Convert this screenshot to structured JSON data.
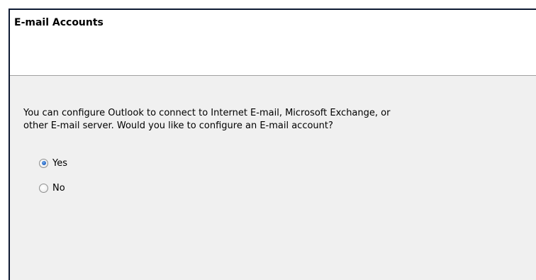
{
  "dialog": {
    "title": "E-mail Accounts"
  },
  "content": {
    "description_line1": "You can configure Outlook to connect to Internet E-mail, Microsoft Exchange, or",
    "description_line2": "other E-mail server. Would you like to configure an E-mail account?",
    "options": [
      {
        "label": "Yes",
        "selected": true
      },
      {
        "label": "No",
        "selected": false
      }
    ]
  }
}
